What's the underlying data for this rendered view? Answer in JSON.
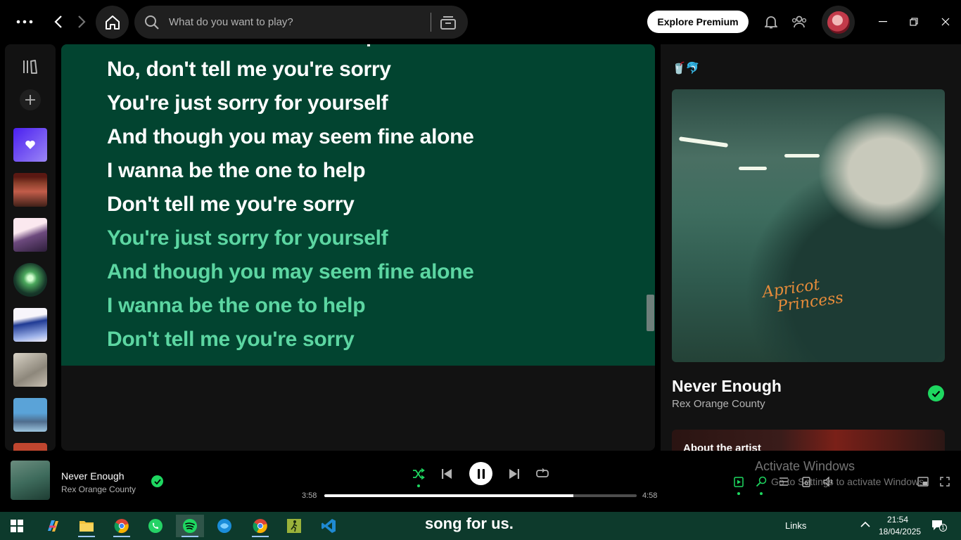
{
  "topbar": {
    "search_placeholder": "What do you want to play?",
    "premium_label": "Explore Premium"
  },
  "lyrics": {
    "lines": [
      {
        "text": "No, don't tell me you're sorry",
        "state": "past"
      },
      {
        "text": "You're just sorry for yourself",
        "state": "past"
      },
      {
        "text": "And though you may seem fine alone",
        "state": "past"
      },
      {
        "text": "I wanna be the one to help",
        "state": "past"
      },
      {
        "text": "Don't tell me you're sorry",
        "state": "past"
      },
      {
        "text": "You're just sorry for yourself",
        "state": "future"
      },
      {
        "text": "And though you may seem fine alone",
        "state": "future"
      },
      {
        "text": "I wanna be the one to help",
        "state": "future"
      },
      {
        "text": "Don't tell me you're sorry",
        "state": "future"
      }
    ],
    "background": "#024430",
    "active_color": "#ffffff",
    "upcoming_color": "#5cd6a2"
  },
  "now_playing_view": {
    "playlist_emoji": "🥤🐬",
    "cover_text": [
      "Apricot",
      "Princess"
    ],
    "title": "Never Enough",
    "artist": "Rex Orange County",
    "about_label": "About the artist"
  },
  "player": {
    "title": "Never Enough",
    "artist": "Rex Orange County",
    "current_time": "3:58",
    "total_time": "4:58",
    "progress": 0.798,
    "shuffle_on": true,
    "is_playing": true,
    "accent": "#1ed760"
  },
  "watermark": {
    "line1": "Activate Windows",
    "line2": "Go to Settings to activate Windows."
  },
  "taskbar": {
    "ticker": "song for us.",
    "links_label": "Links",
    "time": "21:54",
    "date": "18/04/2025",
    "notification_count": "1",
    "apps": [
      "windows-start",
      "copilot",
      "file-explorer",
      "chrome",
      "whatsapp",
      "spotify",
      "edge-fish",
      "chrome-profile",
      "pedestrian-app",
      "vscode"
    ]
  }
}
